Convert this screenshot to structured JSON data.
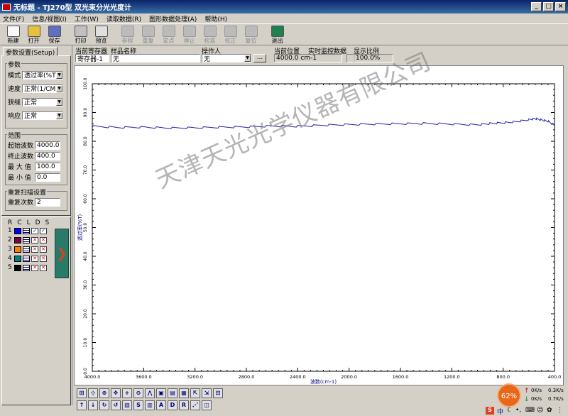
{
  "window": {
    "title": "无标题 - TJ270型 双光束分光光度计"
  },
  "menu": [
    "文件(F)",
    "信息/视图(I)",
    "工作(W)",
    "读取数据(R)",
    "图形数据处理(A)",
    "帮助(H)"
  ],
  "toolbar": [
    {
      "label": "新建",
      "enabled": true
    },
    {
      "label": "打开",
      "enabled": true
    },
    {
      "label": "保存",
      "enabled": true
    },
    {
      "label": "打印",
      "enabled": true
    },
    {
      "label": "预览",
      "enabled": true
    },
    {
      "label": "参程",
      "enabled": false
    },
    {
      "label": "重复",
      "enabled": false
    },
    {
      "label": "定点",
      "enabled": false
    },
    {
      "label": "停止",
      "enabled": false
    },
    {
      "label": "检准",
      "enabled": false
    },
    {
      "label": "校正",
      "enabled": false
    },
    {
      "label": "复位",
      "enabled": false
    },
    {
      "label": "退出",
      "enabled": true
    }
  ],
  "settings": {
    "tab": "参数设置(Setup)",
    "param_group": "参数",
    "mode_label": "模式",
    "mode_value": "透过率(%T)",
    "speed_label": "速度",
    "speed_value": "正常(1/CM)",
    "slit_label": "狭缝",
    "slit_value": "正常",
    "response_label": "响应",
    "response_value": "正常",
    "range_group": "范围",
    "start_label": "起始波数",
    "start_value": "4000.0",
    "end_label": "终止波数",
    "end_value": "400.0",
    "max_label": "最 大 值",
    "max_value": "100.0",
    "min_label": "最 小 值",
    "min_value": "0.0",
    "repeat_group": "重复扫描设置",
    "repeat_label": "重复次数",
    "repeat_value": "2"
  },
  "traces": {
    "headers": [
      "R",
      "C",
      "L",
      "D",
      "S"
    ],
    "rows": [
      {
        "num": "1",
        "color": "#0000ff"
      },
      {
        "num": "2",
        "color": "#800040"
      },
      {
        "num": "3",
        "color": "#ff8000"
      },
      {
        "num": "4",
        "color": "#008080"
      },
      {
        "num": "5",
        "color": "#000000"
      }
    ]
  },
  "info": {
    "reg_label": "当前寄存器",
    "reg_value": "寄存器-1",
    "sample_label": "样品名称",
    "sample_value": "无",
    "operator_label": "操作人",
    "operator_value": "无",
    "browse_label": "...",
    "pos_label": "当前位置",
    "pos_value": "4000.0 cm-1",
    "monitor_label": "实时监控数据",
    "monitor_value": "",
    "scale_label": "显示比例",
    "scale_value": "100.0%"
  },
  "watermark": "天津天光光学仪器有限公司",
  "chart_data": {
    "type": "line",
    "xlabel": "波数(cm-1)",
    "ylabel": "透过率(%T)",
    "xlim": [
      4000,
      400
    ],
    "ylim": [
      0,
      100
    ],
    "xticks": [
      "4000.0",
      "3600.0",
      "3200.0",
      "2800.0",
      "2400.0",
      "2000.0",
      "1600.0",
      "1200.0",
      "800.0",
      "400.0"
    ],
    "yticks": [
      "0.0",
      "10.0",
      "20.0",
      "30.0",
      "40.0",
      "50.0",
      "60.0",
      "70.0",
      "80.0",
      "90.0",
      "100.0"
    ],
    "series": [
      {
        "x": [
          4000,
          3800,
          3600,
          3400,
          3200,
          3000,
          2800,
          2600,
          2400,
          2200,
          2000,
          1800,
          1600,
          1400,
          1200,
          1000,
          900,
          800,
          700,
          600,
          550,
          500,
          450,
          400
        ],
        "y": [
          85.2,
          84.8,
          84.9,
          84.6,
          84.7,
          84.9,
          85.0,
          85.3,
          85.2,
          85.6,
          85.8,
          86.0,
          86.1,
          86.2,
          86.0,
          85.7,
          86.2,
          86.4,
          86.8,
          87.5,
          87.9,
          87.4,
          87.0,
          85.5
        ],
        "color": "#2020a0"
      }
    ]
  },
  "tray": {
    "percent": "62%",
    "up": "0K/s",
    "down": "0K/s",
    "r1": "0.3K/s",
    "r2": "0.7K/s",
    "ime": "中"
  }
}
